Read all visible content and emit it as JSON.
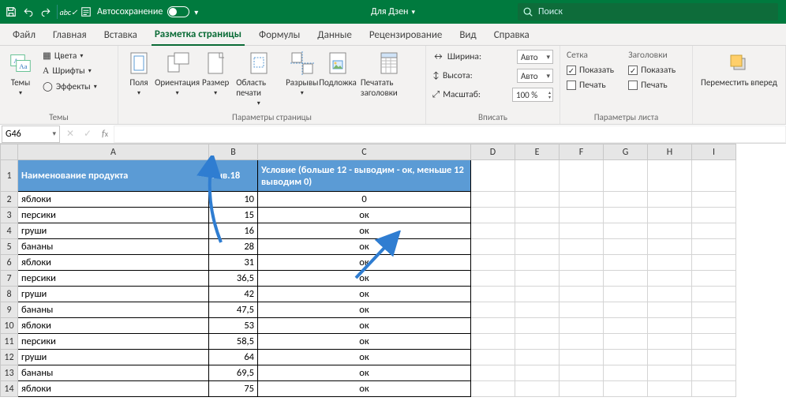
{
  "titlebar": {
    "autosave_label": "Автосохранение",
    "doc_title": "Для Дзен",
    "search_placeholder": "Поиск"
  },
  "tabs": {
    "file": "Файл",
    "home": "Главная",
    "insert": "Вставка",
    "page_layout": "Разметка страницы",
    "formulas": "Формулы",
    "data": "Данные",
    "review": "Рецензирование",
    "view": "Вид",
    "help": "Справка"
  },
  "ribbon": {
    "themes": {
      "themes": "Темы",
      "colors": "Цвета",
      "fonts": "Шрифты",
      "effects": "Эффекты",
      "group": "Темы"
    },
    "page": {
      "margins": "Поля",
      "orientation": "Ориентация",
      "size": "Размер",
      "print_area": "Область печати",
      "breaks": "Разрывы",
      "background": "Подложка",
      "print_titles": "Печатать заголовки",
      "group": "Параметры страницы"
    },
    "fit": {
      "width": "Ширина:",
      "height": "Высота:",
      "scale": "Масштаб:",
      "auto": "Авто",
      "scale_val": "100 %",
      "group": "Вписать"
    },
    "sheet_opts": {
      "grid": "Сетка",
      "headings": "Заголовки",
      "show": "Показать",
      "print": "Печать",
      "group": "Параметры листа"
    },
    "arrange": {
      "bring_forward": "Переместить вперед"
    }
  },
  "namebox": "G46",
  "headers": {
    "a": "Наименование продукта",
    "b": "янв.18",
    "c": "Условие (больше 12 - выводим - ок, меньше 12 выводим 0)"
  },
  "rows": [
    {
      "a": "яблоки",
      "b": "10",
      "c": "0"
    },
    {
      "a": "персики",
      "b": "15",
      "c": "ок"
    },
    {
      "a": "груши",
      "b": "16",
      "c": "ок"
    },
    {
      "a": "бананы",
      "b": "28",
      "c": "ок"
    },
    {
      "a": "яблоки",
      "b": "31",
      "c": "ок"
    },
    {
      "a": "персики",
      "b": "36,5",
      "c": "ок"
    },
    {
      "a": "груши",
      "b": "42",
      "c": "ок"
    },
    {
      "a": "бананы",
      "b": "47,5",
      "c": "ок"
    },
    {
      "a": "яблоки",
      "b": "53",
      "c": "ок"
    },
    {
      "a": "персики",
      "b": "58,5",
      "c": "ок"
    },
    {
      "a": "груши",
      "b": "64",
      "c": "ок"
    },
    {
      "a": "бананы",
      "b": "69,5",
      "c": "ок"
    },
    {
      "a": "яблоки",
      "b": "75",
      "c": "ок"
    }
  ],
  "cols": [
    "A",
    "B",
    "C",
    "D",
    "E",
    "F",
    "G",
    "H",
    "I"
  ]
}
